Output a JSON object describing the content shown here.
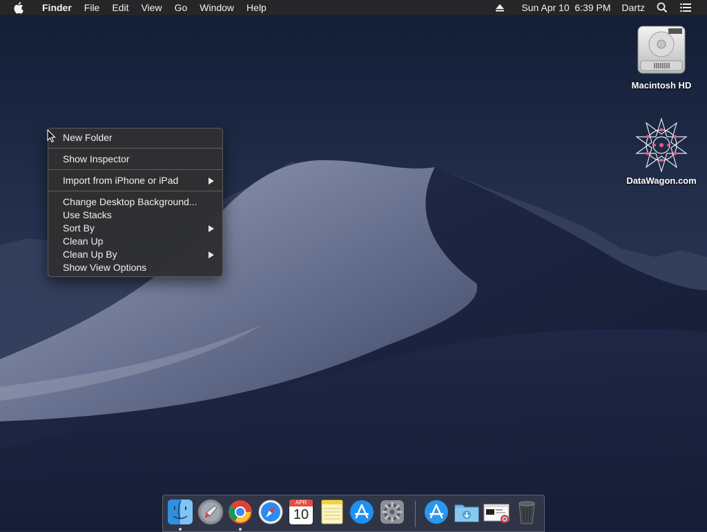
{
  "menubar": {
    "apple_icon": "apple-logo-icon",
    "app_name": "Finder",
    "menus": [
      "File",
      "Edit",
      "View",
      "Go",
      "Window",
      "Help"
    ],
    "right": {
      "eject_icon": "eject-icon",
      "clock": "Sun Apr 10  6:39 PM",
      "user": "Dartz",
      "spotlight_icon": "search-icon",
      "notification_icon": "list-icon"
    }
  },
  "context_menu": {
    "items": [
      {
        "label": "New Folder"
      },
      {
        "label": "Show Inspector"
      },
      {
        "label": "Import from iPhone or iPad",
        "submenu": true
      },
      {
        "label": "Change Desktop Background..."
      },
      {
        "label": "Use Stacks"
      },
      {
        "label": "Sort By",
        "submenu": true
      },
      {
        "label": "Clean Up"
      },
      {
        "label": "Clean Up By",
        "submenu": true
      },
      {
        "label": "Show View Options"
      }
    ]
  },
  "desktop_icons": [
    {
      "label": "Macintosh HD",
      "icon": "hard-drive-icon"
    },
    {
      "label": "DataWagon.com",
      "icon": "geometric-star-icon"
    }
  ],
  "dock": {
    "items": [
      {
        "name": "Finder",
        "icon": "finder-icon",
        "running": true
      },
      {
        "name": "Launchpad",
        "icon": "rocket-icon",
        "running": false
      },
      {
        "name": "Google Chrome",
        "icon": "chrome-icon",
        "running": true
      },
      {
        "name": "Safari",
        "icon": "compass-icon",
        "running": false
      },
      {
        "name": "Calendar",
        "icon": "calendar-icon",
        "running": false,
        "month": "APR",
        "day": "10"
      },
      {
        "name": "Notes",
        "icon": "notes-icon",
        "running": false
      },
      {
        "name": "App Store",
        "icon": "app-store-icon",
        "running": false
      },
      {
        "name": "System Preferences",
        "icon": "gear-icon",
        "running": false
      },
      {
        "name": "Applications",
        "icon": "app-store-folder-icon",
        "running": false
      },
      {
        "name": "Downloads",
        "icon": "downloads-folder-icon",
        "running": false
      },
      {
        "name": "Chrome window",
        "icon": "window-thumbnail-icon",
        "running": false
      },
      {
        "name": "Trash",
        "icon": "trash-icon",
        "running": false
      }
    ]
  },
  "colors": {
    "menubar_bg": "#262628",
    "menu_bg": "#303032",
    "sky_top": "#15203a",
    "sky_bottom": "#2a3658",
    "dune_light": "#8b93ad",
    "dune_dark": "#1a2240"
  }
}
